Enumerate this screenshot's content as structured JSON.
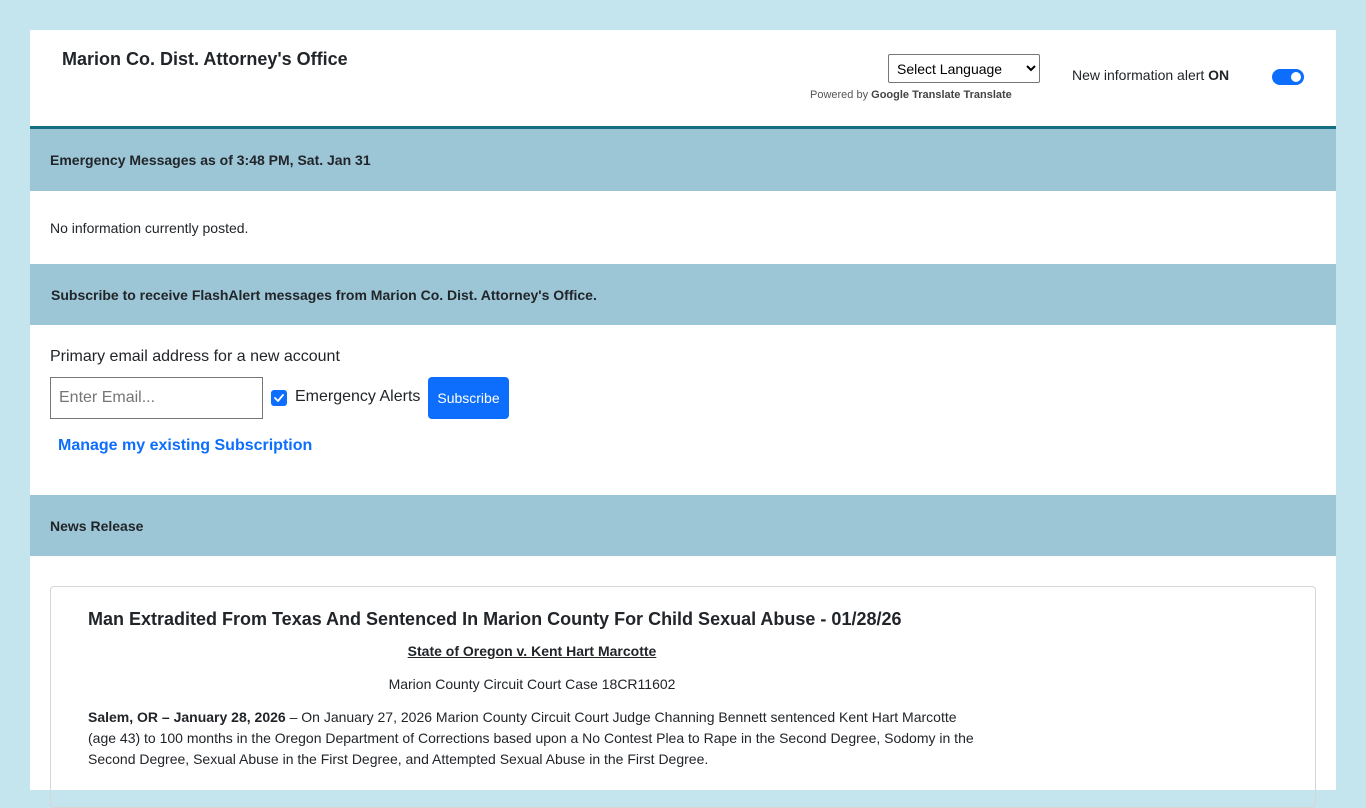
{
  "header": {
    "org_title": "Marion Co. Dist. Attorney's Office",
    "language_select": "Select Language",
    "powered_by": "Powered by",
    "google_translate_img_alt": "Google Translate",
    "translate_label": "Translate",
    "alert_label": "New information alert",
    "alert_state": "ON"
  },
  "emergency": {
    "heading": "Emergency Messages as of 3:48 PM, Sat. Jan 31",
    "message": "No information currently posted."
  },
  "subscribe": {
    "heading": "Subscribe to receive FlashAlert messages from Marion Co. Dist. Attorney's Office.",
    "email_label": "Primary email address for a new account",
    "email_placeholder": "Enter Email...",
    "checkbox_label": "Emergency Alerts",
    "button_label": "Subscribe",
    "manage_link": "Manage my existing Subscription"
  },
  "news": {
    "heading": "News Release",
    "title": "Man Extradited From Texas And Sentenced In Marion County For Child Sexual Abuse - 01/28/26",
    "case_name": "State of Oregon v. Kent Hart Marcotte",
    "case_number": "Marion County Circuit Court Case 18CR11602",
    "dateline": "Salem, OR – January 28, 2026",
    "body": " –  On January 27, 2026 Marion County Circuit Court Judge Channing Bennett sentenced Kent Hart Marcotte (age 43) to 100 months in the Oregon Department of Corrections based upon a No Contest Plea to Rape in the Second Degree, Sodomy in the Second Degree, Sexual Abuse in the First Degree, and Attempted Sexual Abuse in the First Degree."
  },
  "colors": {
    "page_bg": "#c4e4ee",
    "band_bg": "#9cc6d6",
    "accent_line": "#136f80",
    "primary": "#0d6efd"
  },
  "icons": {
    "toggle": "toggle-switch-on",
    "checkbox": "checkmark-icon"
  }
}
